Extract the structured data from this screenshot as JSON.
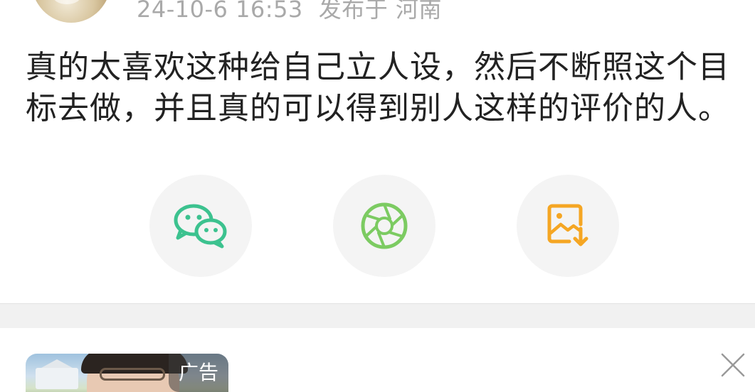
{
  "post": {
    "timestamp": "24-10-6 16:53",
    "location": "发布于 河南",
    "text": "真的太喜欢这种给自己立人设，然后不断照这个目标去做，并且真的可以得到别人这样的评价的人。"
  },
  "share": {
    "buttons": [
      {
        "icon": "wechat-icon",
        "color": "#3cc28f"
      },
      {
        "icon": "moments-icon",
        "color": "#7ccb62"
      },
      {
        "icon": "save-image-icon",
        "color": "#f5a623"
      }
    ]
  },
  "ad": {
    "badge": "广告"
  },
  "colors": {
    "meta_text": "#a9a9a9",
    "body_text": "#222222",
    "button_bg": "#f4f4f4",
    "divider": "#f1f1f1"
  }
}
